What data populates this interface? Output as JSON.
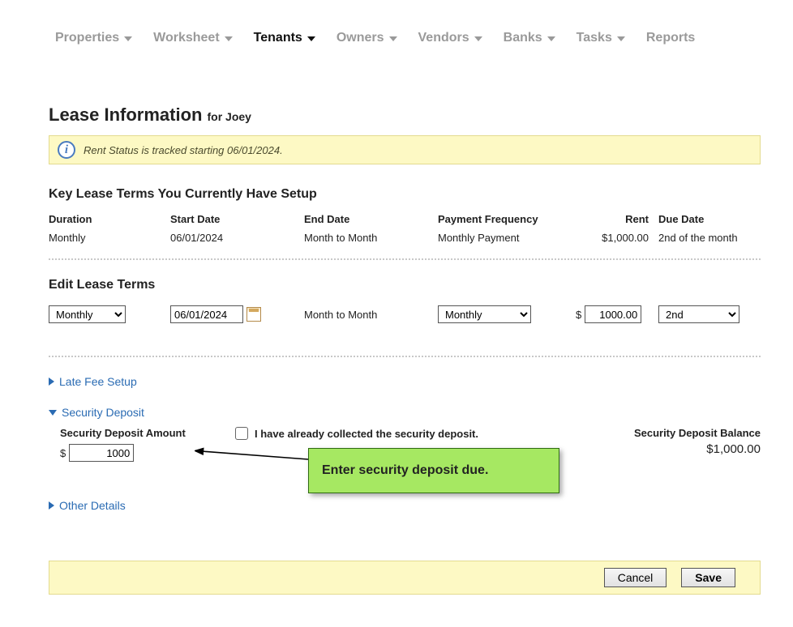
{
  "nav": {
    "items": [
      {
        "label": "Properties",
        "active": false,
        "caret": true
      },
      {
        "label": "Worksheet",
        "active": false,
        "caret": true
      },
      {
        "label": "Tenants",
        "active": true,
        "caret": true
      },
      {
        "label": "Owners",
        "active": false,
        "caret": true
      },
      {
        "label": "Vendors",
        "active": false,
        "caret": true
      },
      {
        "label": "Banks",
        "active": false,
        "caret": true
      },
      {
        "label": "Tasks",
        "active": false,
        "caret": true
      },
      {
        "label": "Reports",
        "active": false,
        "caret": false
      }
    ]
  },
  "page": {
    "title": "Lease Information",
    "for_prefix": "for",
    "tenant_name": "Joey"
  },
  "info_banner": {
    "text": "Rent Status is tracked starting 06/01/2024."
  },
  "key_terms": {
    "heading": "Key Lease Terms You Currently Have Setup",
    "headers": {
      "duration": "Duration",
      "start_date": "Start Date",
      "end_date": "End Date",
      "payment_frequency": "Payment Frequency",
      "rent": "Rent",
      "due_date": "Due Date"
    },
    "values": {
      "duration": "Monthly",
      "start_date": "06/01/2024",
      "end_date": "Month to Month",
      "payment_frequency": "Monthly Payment",
      "rent": "$1,000.00",
      "due_date": "2nd of the month"
    }
  },
  "edit_terms": {
    "heading": "Edit Lease Terms",
    "duration_value": "Monthly",
    "start_date_value": "06/01/2024",
    "end_date_text": "Month to Month",
    "frequency_value": "Monthly",
    "currency_symbol": "$",
    "rent_value": "1000.00",
    "due_value": "2nd"
  },
  "sections": {
    "late_fee": "Late Fee Setup",
    "security_deposit": "Security Deposit",
    "other_details": "Other Details"
  },
  "security_deposit": {
    "amount_label": "Security Deposit Amount",
    "currency_symbol": "$",
    "amount_value": "1000",
    "collected_label": "I have already collected the security deposit.",
    "collected_checked": false,
    "balance_label": "Security Deposit Balance",
    "balance_value": "$1,000.00"
  },
  "callout": {
    "text": "Enter security deposit due."
  },
  "footer": {
    "cancel": "Cancel",
    "save": "Save"
  }
}
